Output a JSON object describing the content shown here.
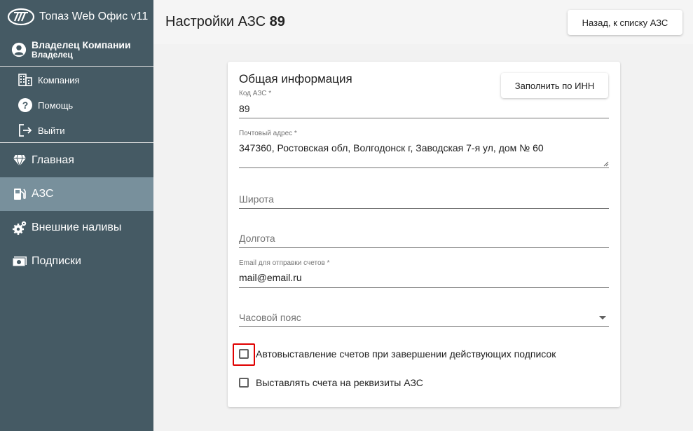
{
  "brand": {
    "title": "Топаз Web Офис v11"
  },
  "user": {
    "name": "Владелец Компании",
    "role": "Владелец"
  },
  "submenu": [
    {
      "label": "Компания",
      "icon": "building-icon"
    },
    {
      "label": "Помощь",
      "icon": "help-icon"
    },
    {
      "label": "Выйти",
      "icon": "logout-icon"
    }
  ],
  "menu": [
    {
      "label": "Главная",
      "icon": "diamond-icon",
      "active": false
    },
    {
      "label": "АЗС",
      "icon": "fuel-pump-icon",
      "active": true
    },
    {
      "label": "Внешние наливы",
      "icon": "gears-icon",
      "active": false
    },
    {
      "label": "Подписки",
      "icon": "money-icon",
      "active": false
    }
  ],
  "header": {
    "title_prefix": "Настройки АЗС",
    "title_number": "89",
    "back_label": "Назад, к списку АЗС"
  },
  "card": {
    "title": "Общая информация",
    "inn_label": "Заполнить по ИНН",
    "code_label": "Код АЗС *",
    "code_value": "89",
    "address_label": "Почтовый адрес *",
    "address_value": "347360, Ростовская обл, Волгодонск г, Заводская 7-я ул, дом № 60",
    "lat_placeholder": "Широта",
    "lon_placeholder": "Долгота",
    "email_label": "Email для отправки счетов *",
    "email_value": "mail@email.ru",
    "tz_placeholder": "Часовой пояс",
    "cb_auto_label": "Автовыставление счетов при завершении действующих подписок",
    "cb_req_label": "Выставлять счета на реквизиты АЗС",
    "cb_auto_checked": false,
    "cb_req_checked": false
  },
  "colors": {
    "sidebar": "#455a64",
    "active": "#78909c",
    "highlight": "#e00000"
  }
}
